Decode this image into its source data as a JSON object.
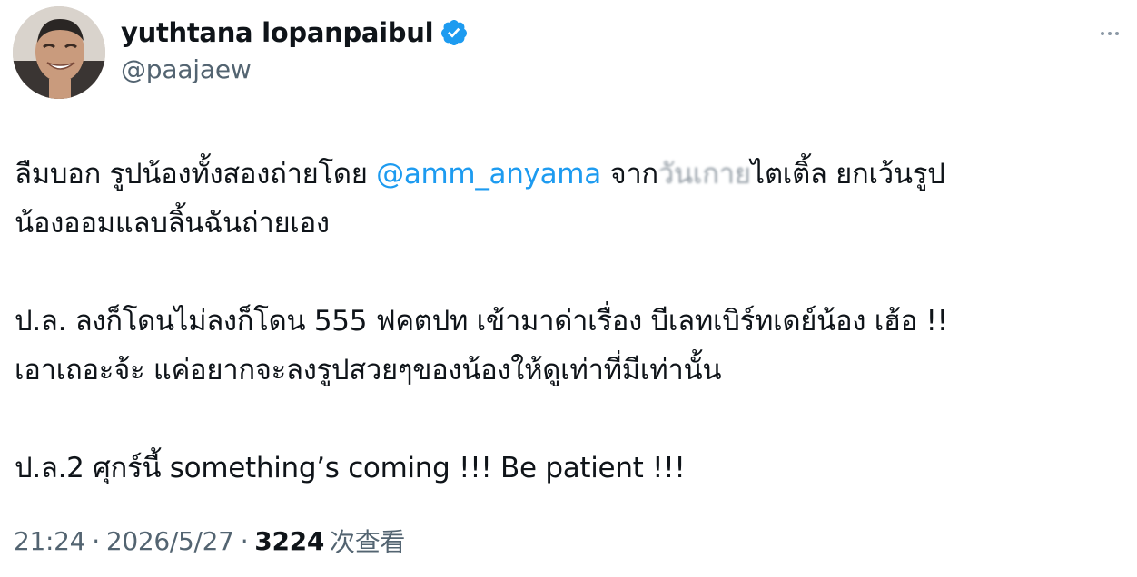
{
  "author": {
    "display_name": "yuthtana lopanpaibul",
    "handle": "@paajaew",
    "verified": true,
    "avatar_icon": "profile-photo"
  },
  "tweet": {
    "line1_prefix": "ลืมบอก รูปน้องทั้งสองถ่ายโดย ",
    "mention": "@amm_anyama",
    "line1_mid": "  จาก",
    "line1_blurred": "วันเกาย",
    "line1_suffix": "ไตเติ้ล  ยกเว้นรูป",
    "line2": "น้องออมแลบลิ้นฉันถ่ายเอง",
    "line4": "ป.ล. ลงก็โดนไม่ลงก็โดน 555 ฟคตปท  เข้ามาด่าเรื่อง บีเลทเบิร์ทเดย์น้อง  เฮ้อ !!",
    "line5": "เอาเถอะจ้ะ  แค่อยากจะลงรูปสวยๆของน้องให้ดูเท่าที่มีเท่านั้น",
    "line7": "ป.ล.2 ศุกร์นี้  something’s coming !!!  Be patient !!!"
  },
  "meta": {
    "time": "21:24",
    "separator": "·",
    "date": "2026/5/27",
    "views_count": "3224",
    "views_label": "次查看"
  },
  "colors": {
    "text": "#0f1419",
    "secondary": "#536471",
    "link": "#1d9bf0",
    "verified_badge": "#1d9bf0"
  }
}
